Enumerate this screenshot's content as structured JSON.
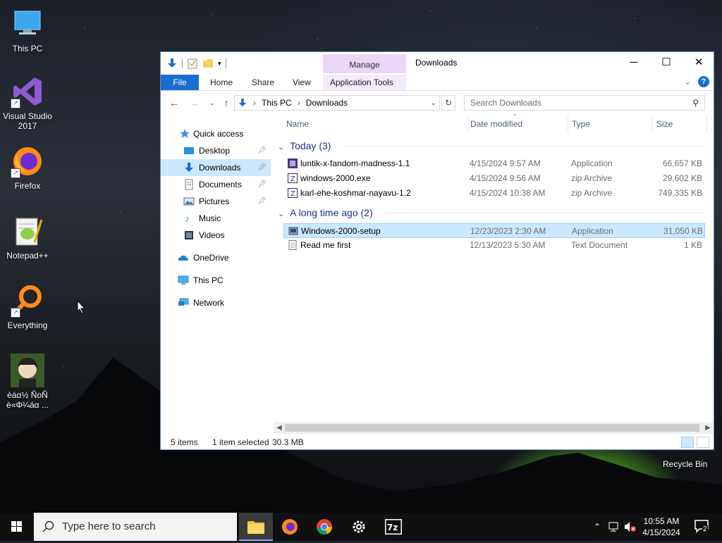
{
  "desktop": {
    "icons": [
      {
        "label": "This PC"
      },
      {
        "label": "Visual Studio 2017"
      },
      {
        "label": "Firefox"
      },
      {
        "label": "Notepad++"
      },
      {
        "label": "Everything"
      },
      {
        "label": "èáα½ ÑoÑ è«Φ¼áα ..."
      }
    ],
    "recycle_bin": "Recycle Bin"
  },
  "window": {
    "title": "Downloads",
    "manage_tab": "Manage",
    "ribbon_tabs": [
      "File",
      "Home",
      "Share",
      "View",
      "Application Tools"
    ],
    "address": {
      "crumbs": [
        "This PC",
        "Downloads"
      ]
    },
    "search_placeholder": "Search Downloads",
    "nav": {
      "items": [
        {
          "label": "Quick access"
        },
        {
          "label": "Desktop"
        },
        {
          "label": "Downloads"
        },
        {
          "label": "Documents"
        },
        {
          "label": "Pictures"
        },
        {
          "label": "Music"
        },
        {
          "label": "Videos"
        },
        {
          "label": "OneDrive"
        },
        {
          "label": "This PC"
        },
        {
          "label": "Network"
        }
      ]
    },
    "columns": [
      "Name",
      "Date modified",
      "Type",
      "Size"
    ],
    "groups": [
      {
        "label": "Today (3)",
        "files": [
          {
            "name": "luntik-x-fandom-madness-1.1",
            "date": "4/15/2024 9:57 AM",
            "type": "Application",
            "size": "66,657 KB"
          },
          {
            "name": "windows-2000.exe",
            "date": "4/15/2024 9:56 AM",
            "type": "zip Archive",
            "size": "29,602 KB"
          },
          {
            "name": "karl-ehe-koshmar-nayavu-1.2",
            "date": "4/15/2024 10:38 AM",
            "type": "zip Archive",
            "size": "749,335 KB"
          }
        ]
      },
      {
        "label": "A long time ago (2)",
        "files": [
          {
            "name": "Windows-2000-setup",
            "date": "12/23/2023 2:30 AM",
            "type": "Application",
            "size": "31,050 KB"
          },
          {
            "name": "Read me first",
            "date": "12/13/2023 5:30 AM",
            "type": "Text Document",
            "size": "1 KB"
          }
        ]
      }
    ],
    "status": {
      "items": "5 items",
      "selected": "1 item selected",
      "size": "30.3 MB"
    }
  },
  "taskbar": {
    "search_placeholder": "Type here to search",
    "time": "10:55 AM",
    "date": "4/15/2024",
    "notification_count": "2"
  },
  "colors": {
    "accent": "#1a6ed1",
    "selection": "#cce8ff",
    "manage": "#e8d7f6"
  }
}
